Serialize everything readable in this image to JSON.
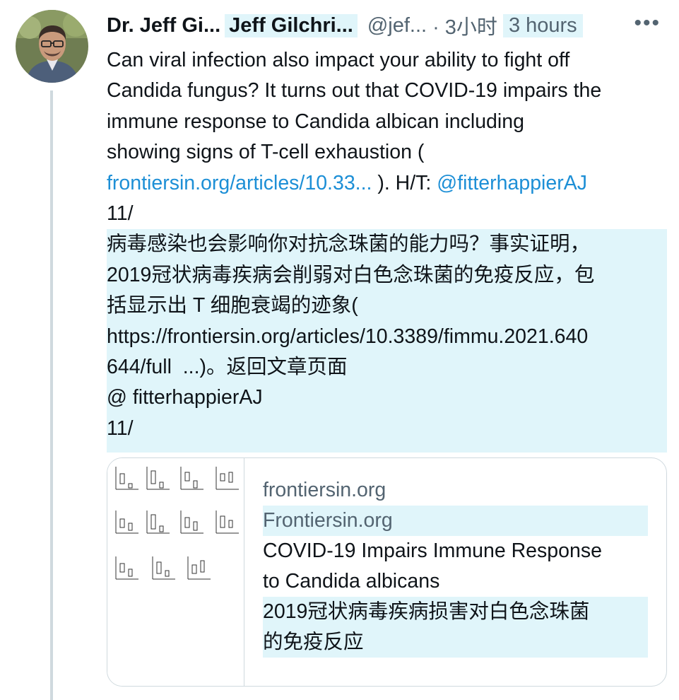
{
  "tweet": {
    "author_name": "Dr. Jeff Gi...",
    "author_name_translated": "Jeff Gilchri...",
    "handle": "@jef...",
    "time": "· 3小时",
    "time_translated": "3 hours",
    "more_label": "•••",
    "text_lines": [
      "Can viral infection also impact your ability to fight off",
      "Candida fungus? It turns out that COVID-19 impairs the",
      "immune response to Candida albican including",
      "showing signs of T-cell exhaustion ("
    ],
    "link_text": "frontiersin.org/articles/10.33...",
    "link_suffix": "). H/T: ",
    "mention": "@fitterhappierAJ",
    "thread_number": "11/",
    "translation_lines": [
      "病毒感染也会影响你对抗念珠菌的能力吗？事实证明，",
      "2019冠状病毒疾病会削弱对白色念珠菌的免疫反应，包",
      "括显示出 T 细胞衰竭的迹象(",
      "https://frontiersin.org/articles/10.3389/fimmu.2021.640",
      "644/full  ...)。返回文章页面",
      "@ fitterhappierAJ",
      "11/"
    ]
  },
  "card": {
    "domain": "frontiersin.org",
    "domain_translated": "Frontiersin.org",
    "title_lines": [
      "COVID-19 Impairs Immune Response",
      "to Candida albicans"
    ],
    "title_translated_lines": [
      "2019冠状病毒疾病损害对白色念珠菌",
      "的免疫反应"
    ]
  }
}
